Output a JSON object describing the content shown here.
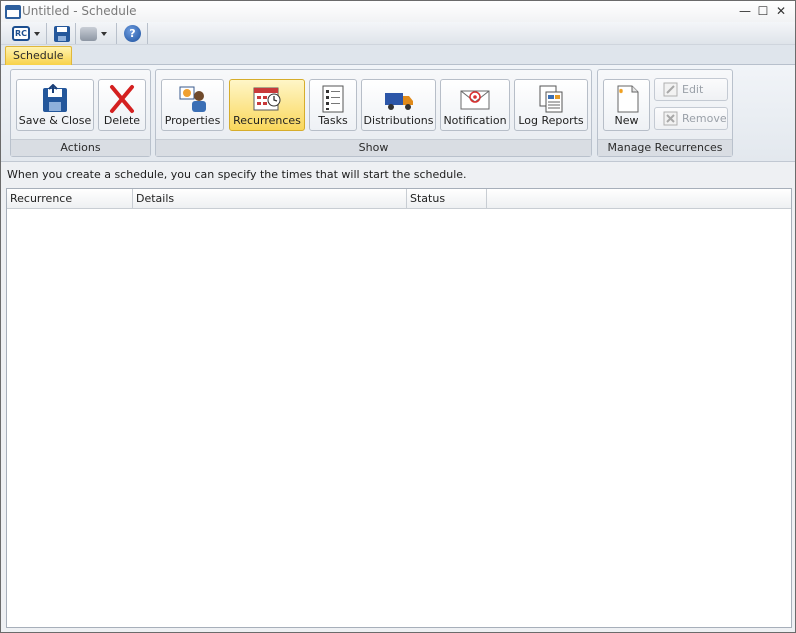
{
  "window": {
    "title": "Untitled - Schedule",
    "controls": {
      "minimize": "—",
      "maximize": "☐",
      "close": "✕"
    }
  },
  "quick_access": {
    "app_icon_text": "RC",
    "icons": [
      "rc-menu-icon",
      "save-icon",
      "print-icon",
      "help-icon"
    ],
    "help_glyph": "?"
  },
  "ribbon": {
    "tabs": [
      {
        "label": "Schedule",
        "active": true
      }
    ],
    "groups": {
      "actions": {
        "label": "Actions",
        "buttons": [
          "Save & Close",
          "Delete"
        ]
      },
      "show": {
        "label": "Show",
        "buttons": [
          "Properties",
          "Recurrences",
          "Tasks",
          "Distributions",
          "Notification",
          "Log Reports"
        ],
        "active": "Recurrences"
      },
      "manage": {
        "label": "Manage Recurrences",
        "new_label": "New",
        "edit_label": "Edit",
        "remove_label": "Remove"
      }
    }
  },
  "info_text": "When you create a schedule, you can specify the times that will start the schedule.",
  "grid": {
    "columns": [
      "Recurrence",
      "Details",
      "Status"
    ],
    "rows": []
  },
  "colors": {
    "active_tab": "#f8d24a",
    "accent_blue": "#2d5f9e",
    "delete_red": "#d42020"
  }
}
